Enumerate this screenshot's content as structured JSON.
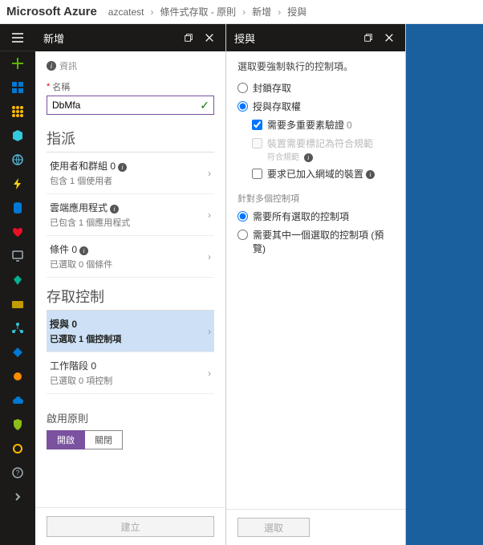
{
  "topbar": {
    "brand": "Microsoft Azure",
    "tenant": "azcatest",
    "crumbs": [
      "條件式存取 - 原則",
      "新增",
      "授與"
    ]
  },
  "rail": {
    "items": [
      {
        "name": "hamburger",
        "glyph": "menu"
      },
      {
        "name": "plus",
        "glyph": "plus"
      },
      {
        "name": "grid-blue",
        "color": "#0078d4"
      },
      {
        "name": "grid-amber",
        "color": "#ffb900"
      },
      {
        "name": "cube",
        "color": "#32c8db"
      },
      {
        "name": "globe",
        "color": "#59b4d9"
      },
      {
        "name": "bolt",
        "color": "#fcd116"
      },
      {
        "name": "db",
        "color": "#0078d4"
      },
      {
        "name": "heart",
        "color": "#e81123"
      },
      {
        "name": "monitor",
        "color": "#a0aeb2"
      },
      {
        "name": "diamond",
        "color": "#00b294"
      },
      {
        "name": "card",
        "color": "#c19c00"
      },
      {
        "name": "network",
        "color": "#32c8db"
      },
      {
        "name": "tag",
        "color": "#0078d4"
      },
      {
        "name": "dot-orange",
        "color": "#ff8c00"
      },
      {
        "name": "cloud",
        "color": "#0078d4"
      },
      {
        "name": "shield",
        "color": "#8cbd18"
      },
      {
        "name": "circle",
        "color": "#ffb900"
      },
      {
        "name": "help",
        "color": "#a0aeb2"
      },
      {
        "name": "chevron",
        "color": "#a0aeb2"
      }
    ]
  },
  "blade_new": {
    "title": "新增",
    "info_label": "資訊",
    "name_label": "名稱",
    "name_value": "DbMfa",
    "section_assign": "指派",
    "rows_assign": [
      {
        "l1": "使用者和群組",
        "cnt": "0",
        "l2": "包含 1 個使用者",
        "info": true
      },
      {
        "l1": "雲端應用程式",
        "cnt": "",
        "l2": "已包含 1 個應用程式",
        "info": true
      },
      {
        "l1": "條件",
        "cnt": "0",
        "l2": "已選取 0 個條件",
        "info": true
      }
    ],
    "section_access": "存取控制",
    "rows_access": [
      {
        "l1": "授與 0",
        "l2": "已選取 1 個控制項",
        "selected": true
      },
      {
        "l1": "工作階段 0",
        "l2": "已選取 0 項控制"
      }
    ],
    "enable_label": "啟用原則",
    "toggle_on": "開啟",
    "toggle_off": "關閉",
    "create_btn": "建立"
  },
  "blade_grant": {
    "title": "授與",
    "desc": "選取要強制執行的控制項。",
    "radio_block": "封鎖存取",
    "radio_grant": "授與存取權",
    "chk_mfa": "需要多重要素驗證",
    "chk_mfa_cnt": "0",
    "chk_compliant": "裝置需要標記為符合規範",
    "chk_compliant_sub": "符合規範",
    "chk_domain": "要求已加入網域的裝置",
    "subhead": "針對多個控制項",
    "radio_all": "需要所有選取的控制項",
    "radio_one": "需要其中一個選取的控制項 (預覽)",
    "select_btn": "選取"
  }
}
